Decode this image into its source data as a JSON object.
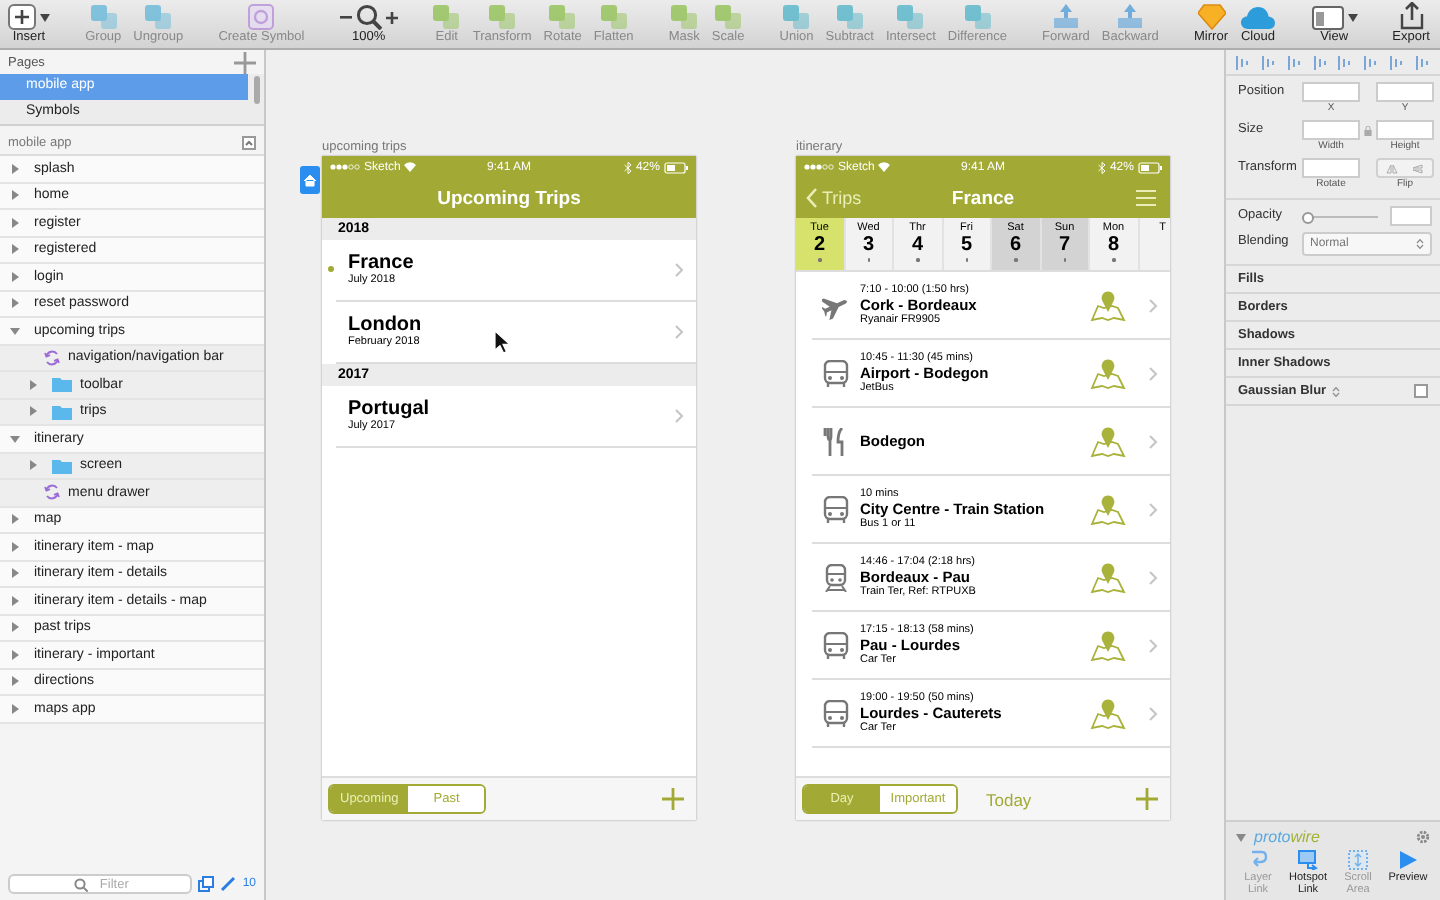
{
  "toolbar": {
    "groups": [
      [
        {
          "label": "Insert",
          "kind": "insert",
          "disabled": false
        }
      ],
      [
        {
          "label": "Group",
          "kind": "shape",
          "disabled": true
        },
        {
          "label": "Ungroup",
          "kind": "shape",
          "disabled": true
        }
      ],
      [
        {
          "label": "Create Symbol",
          "kind": "symbol",
          "disabled": true
        }
      ],
      [
        {
          "label": "100%",
          "kind": "zoom",
          "disabled": false
        }
      ],
      [
        {
          "label": "Edit",
          "kind": "shape",
          "disabled": true
        },
        {
          "label": "Transform",
          "kind": "shape",
          "disabled": true
        },
        {
          "label": "Rotate",
          "kind": "shape",
          "disabled": true
        },
        {
          "label": "Flatten",
          "kind": "shape",
          "disabled": true
        }
      ],
      [
        {
          "label": "Mask",
          "kind": "shape",
          "disabled": true
        },
        {
          "label": "Scale",
          "kind": "shape",
          "disabled": true
        }
      ],
      [
        {
          "label": "Union",
          "kind": "shape",
          "disabled": true
        },
        {
          "label": "Subtract",
          "kind": "shape",
          "disabled": true
        },
        {
          "label": "Intersect",
          "kind": "shape",
          "disabled": true
        },
        {
          "label": "Difference",
          "kind": "shape",
          "disabled": true
        }
      ],
      [
        {
          "label": "Forward",
          "kind": "arrange",
          "disabled": true
        },
        {
          "label": "Backward",
          "kind": "arrange",
          "disabled": true
        }
      ],
      [
        {
          "label": "Mirror",
          "kind": "mirror",
          "disabled": false
        },
        {
          "label": "Cloud",
          "kind": "cloud",
          "disabled": false
        }
      ],
      [
        {
          "label": "View",
          "kind": "view",
          "disabled": false
        }
      ],
      [
        {
          "label": "Export",
          "kind": "export",
          "disabled": false
        }
      ]
    ]
  },
  "sidebar": {
    "pages_title": "Pages",
    "pages": [
      {
        "label": "mobile app",
        "selected": true
      },
      {
        "label": "Symbols",
        "selected": false
      }
    ],
    "layers_title": "mobile app",
    "layers": [
      {
        "label": "splash",
        "kind": "artboard",
        "expanded": false
      },
      {
        "label": "home",
        "kind": "artboard",
        "expanded": false
      },
      {
        "label": "register",
        "kind": "artboard",
        "expanded": false
      },
      {
        "label": "registered",
        "kind": "artboard",
        "expanded": false
      },
      {
        "label": "login",
        "kind": "artboard",
        "expanded": false
      },
      {
        "label": "reset password",
        "kind": "artboard",
        "expanded": false
      },
      {
        "label": "upcoming trips",
        "kind": "artboard",
        "expanded": true,
        "children": [
          {
            "label": "navigation/navigation bar",
            "kind": "symbol"
          },
          {
            "label": "toolbar",
            "kind": "folder",
            "expanded": false
          },
          {
            "label": "trips",
            "kind": "folder",
            "expanded": false
          }
        ]
      },
      {
        "label": "itinerary",
        "kind": "artboard",
        "expanded": true,
        "children": [
          {
            "label": "screen",
            "kind": "folder",
            "expanded": false
          },
          {
            "label": "menu drawer",
            "kind": "symbol"
          }
        ]
      },
      {
        "label": "map",
        "kind": "artboard",
        "expanded": false
      },
      {
        "label": "itinerary item - map",
        "kind": "artboard",
        "expanded": false
      },
      {
        "label": "itinerary item - details",
        "kind": "artboard",
        "expanded": false
      },
      {
        "label": "itinerary item - details - map",
        "kind": "artboard",
        "expanded": false
      },
      {
        "label": "past trips",
        "kind": "artboard",
        "expanded": false
      },
      {
        "label": "itinerary - important",
        "kind": "artboard",
        "expanded": false
      },
      {
        "label": "directions",
        "kind": "artboard",
        "expanded": false
      },
      {
        "label": "maps app",
        "kind": "artboard",
        "expanded": false
      }
    ],
    "filter": {
      "placeholder": "Filter"
    },
    "count": "10"
  },
  "canvas": {
    "artboards": [
      {
        "name": "upcoming trips",
        "home": true,
        "kind": "trip-list",
        "status": {
          "carrier": "Sketch",
          "time": "9:41 AM",
          "battery": "42%"
        },
        "title": "Upcoming Trips",
        "sections": [
          {
            "year": "2018",
            "trips": [
              {
                "name": "France",
                "date": "July 2018",
                "current": true
              },
              {
                "name": "London",
                "date": "February 2018",
                "current": false
              }
            ]
          },
          {
            "year": "2017",
            "trips": [
              {
                "name": "Portugal",
                "date": "July 2017",
                "current": false
              }
            ]
          }
        ],
        "segments": [
          {
            "label": "Upcoming",
            "selected": true
          },
          {
            "label": "Past",
            "selected": false
          }
        ]
      },
      {
        "name": "itinerary",
        "home": false,
        "kind": "itinerary",
        "status": {
          "carrier": "Sketch",
          "time": "9:41 AM",
          "battery": "42%"
        },
        "back": "Trips",
        "title": "France",
        "days": [
          {
            "weekday": "Tue",
            "day": "2",
            "selected": true,
            "weekend": false
          },
          {
            "weekday": "Wed",
            "day": "3",
            "selected": false,
            "weekend": false
          },
          {
            "weekday": "Thr",
            "day": "4",
            "selected": false,
            "weekend": false
          },
          {
            "weekday": "Fri",
            "day": "5",
            "selected": false,
            "weekend": false
          },
          {
            "weekday": "Sat",
            "day": "6",
            "selected": false,
            "weekend": true
          },
          {
            "weekday": "Sun",
            "day": "7",
            "selected": false,
            "weekend": true
          },
          {
            "weekday": "Mon",
            "day": "8",
            "selected": false,
            "weekend": false
          },
          {
            "weekday": "T",
            "selected": false,
            "weekend": false
          }
        ],
        "items": [
          {
            "kind": "flight",
            "time": "7:10 - 10:00 (1:50 hrs)",
            "title": "Cork - Bordeaux",
            "subtitle": "Ryanair FR9905"
          },
          {
            "kind": "bus",
            "time": "10:45 - 11:30 (45 mins)",
            "title": "Airport - Bodegon",
            "subtitle": "JetBus"
          },
          {
            "kind": "restaurant",
            "title": "Bodegon"
          },
          {
            "kind": "bus",
            "time": "10 mins",
            "title": "City Centre - Train Station",
            "subtitle": "Bus 1 or 11"
          },
          {
            "kind": "train",
            "time": "14:46 - 17:04 (2:18 hrs)",
            "title": "Bordeaux - Pau",
            "subtitle": "Train Ter, Ref: RTPUXB"
          },
          {
            "kind": "bus",
            "time": "17:15 - 18:13 (58 mins)",
            "title": "Pau - Lourdes",
            "subtitle": "Car Ter"
          },
          {
            "kind": "bus",
            "time": "19:00 - 19:50 (50 mins)",
            "title": "Lourdes - Cauterets",
            "subtitle": "Car Ter"
          }
        ],
        "segments": [
          {
            "label": "Day",
            "selected": true
          },
          {
            "label": "Important",
            "selected": false
          }
        ],
        "today": "Today"
      }
    ]
  },
  "inspector": {
    "position": {
      "label": "Position",
      "captions": [
        "X",
        "Y"
      ]
    },
    "size": {
      "label": "Size",
      "captions": [
        "Width",
        "Height"
      ]
    },
    "transform": {
      "label": "Transform",
      "rotate": "Rotate",
      "flip": "Flip"
    },
    "opacity": {
      "label": "Opacity",
      "level": 0
    },
    "blending": {
      "label": "Blending",
      "value": "Normal"
    },
    "sections": [
      {
        "label": "Fills",
        "kind": "header"
      },
      {
        "label": "Borders",
        "kind": "header"
      },
      {
        "label": "Shadows",
        "kind": "header"
      },
      {
        "label": "Inner Shadows",
        "kind": "header"
      },
      {
        "label": "Gaussian Blur",
        "kind": "toggle",
        "checked": false
      }
    ],
    "plugin": {
      "logo": [
        "proto",
        "wire"
      ],
      "buttons": [
        {
          "label": "Layer Link",
          "kind": "layer-link",
          "disabled": true
        },
        {
          "label": "Hotspot Link",
          "kind": "hotspot",
          "disabled": false
        },
        {
          "label": "Scroll Area",
          "kind": "scroll",
          "disabled": true
        },
        {
          "label": "Preview",
          "kind": "preview",
          "disabled": false
        }
      ]
    }
  }
}
